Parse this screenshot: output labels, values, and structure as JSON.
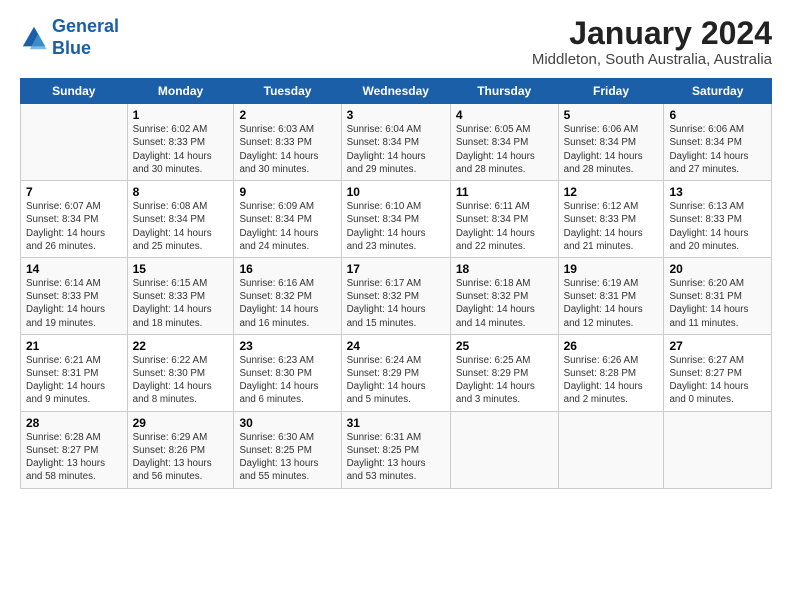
{
  "header": {
    "logo_line1": "General",
    "logo_line2": "Blue",
    "title": "January 2024",
    "subtitle": "Middleton, South Australia, Australia"
  },
  "weekdays": [
    "Sunday",
    "Monday",
    "Tuesday",
    "Wednesday",
    "Thursday",
    "Friday",
    "Saturday"
  ],
  "weeks": [
    [
      {
        "day": "",
        "info": ""
      },
      {
        "day": "1",
        "info": "Sunrise: 6:02 AM\nSunset: 8:33 PM\nDaylight: 14 hours\nand 30 minutes."
      },
      {
        "day": "2",
        "info": "Sunrise: 6:03 AM\nSunset: 8:33 PM\nDaylight: 14 hours\nand 30 minutes."
      },
      {
        "day": "3",
        "info": "Sunrise: 6:04 AM\nSunset: 8:34 PM\nDaylight: 14 hours\nand 29 minutes."
      },
      {
        "day": "4",
        "info": "Sunrise: 6:05 AM\nSunset: 8:34 PM\nDaylight: 14 hours\nand 28 minutes."
      },
      {
        "day": "5",
        "info": "Sunrise: 6:06 AM\nSunset: 8:34 PM\nDaylight: 14 hours\nand 28 minutes."
      },
      {
        "day": "6",
        "info": "Sunrise: 6:06 AM\nSunset: 8:34 PM\nDaylight: 14 hours\nand 27 minutes."
      }
    ],
    [
      {
        "day": "7",
        "info": "Sunrise: 6:07 AM\nSunset: 8:34 PM\nDaylight: 14 hours\nand 26 minutes."
      },
      {
        "day": "8",
        "info": "Sunrise: 6:08 AM\nSunset: 8:34 PM\nDaylight: 14 hours\nand 25 minutes."
      },
      {
        "day": "9",
        "info": "Sunrise: 6:09 AM\nSunset: 8:34 PM\nDaylight: 14 hours\nand 24 minutes."
      },
      {
        "day": "10",
        "info": "Sunrise: 6:10 AM\nSunset: 8:34 PM\nDaylight: 14 hours\nand 23 minutes."
      },
      {
        "day": "11",
        "info": "Sunrise: 6:11 AM\nSunset: 8:34 PM\nDaylight: 14 hours\nand 22 minutes."
      },
      {
        "day": "12",
        "info": "Sunrise: 6:12 AM\nSunset: 8:33 PM\nDaylight: 14 hours\nand 21 minutes."
      },
      {
        "day": "13",
        "info": "Sunrise: 6:13 AM\nSunset: 8:33 PM\nDaylight: 14 hours\nand 20 minutes."
      }
    ],
    [
      {
        "day": "14",
        "info": "Sunrise: 6:14 AM\nSunset: 8:33 PM\nDaylight: 14 hours\nand 19 minutes."
      },
      {
        "day": "15",
        "info": "Sunrise: 6:15 AM\nSunset: 8:33 PM\nDaylight: 14 hours\nand 18 minutes."
      },
      {
        "day": "16",
        "info": "Sunrise: 6:16 AM\nSunset: 8:32 PM\nDaylight: 14 hours\nand 16 minutes."
      },
      {
        "day": "17",
        "info": "Sunrise: 6:17 AM\nSunset: 8:32 PM\nDaylight: 14 hours\nand 15 minutes."
      },
      {
        "day": "18",
        "info": "Sunrise: 6:18 AM\nSunset: 8:32 PM\nDaylight: 14 hours\nand 14 minutes."
      },
      {
        "day": "19",
        "info": "Sunrise: 6:19 AM\nSunset: 8:31 PM\nDaylight: 14 hours\nand 12 minutes."
      },
      {
        "day": "20",
        "info": "Sunrise: 6:20 AM\nSunset: 8:31 PM\nDaylight: 14 hours\nand 11 minutes."
      }
    ],
    [
      {
        "day": "21",
        "info": "Sunrise: 6:21 AM\nSunset: 8:31 PM\nDaylight: 14 hours\nand 9 minutes."
      },
      {
        "day": "22",
        "info": "Sunrise: 6:22 AM\nSunset: 8:30 PM\nDaylight: 14 hours\nand 8 minutes."
      },
      {
        "day": "23",
        "info": "Sunrise: 6:23 AM\nSunset: 8:30 PM\nDaylight: 14 hours\nand 6 minutes."
      },
      {
        "day": "24",
        "info": "Sunrise: 6:24 AM\nSunset: 8:29 PM\nDaylight: 14 hours\nand 5 minutes."
      },
      {
        "day": "25",
        "info": "Sunrise: 6:25 AM\nSunset: 8:29 PM\nDaylight: 14 hours\nand 3 minutes."
      },
      {
        "day": "26",
        "info": "Sunrise: 6:26 AM\nSunset: 8:28 PM\nDaylight: 14 hours\nand 2 minutes."
      },
      {
        "day": "27",
        "info": "Sunrise: 6:27 AM\nSunset: 8:27 PM\nDaylight: 14 hours\nand 0 minutes."
      }
    ],
    [
      {
        "day": "28",
        "info": "Sunrise: 6:28 AM\nSunset: 8:27 PM\nDaylight: 13 hours\nand 58 minutes."
      },
      {
        "day": "29",
        "info": "Sunrise: 6:29 AM\nSunset: 8:26 PM\nDaylight: 13 hours\nand 56 minutes."
      },
      {
        "day": "30",
        "info": "Sunrise: 6:30 AM\nSunset: 8:25 PM\nDaylight: 13 hours\nand 55 minutes."
      },
      {
        "day": "31",
        "info": "Sunrise: 6:31 AM\nSunset: 8:25 PM\nDaylight: 13 hours\nand 53 minutes."
      },
      {
        "day": "",
        "info": ""
      },
      {
        "day": "",
        "info": ""
      },
      {
        "day": "",
        "info": ""
      }
    ]
  ]
}
